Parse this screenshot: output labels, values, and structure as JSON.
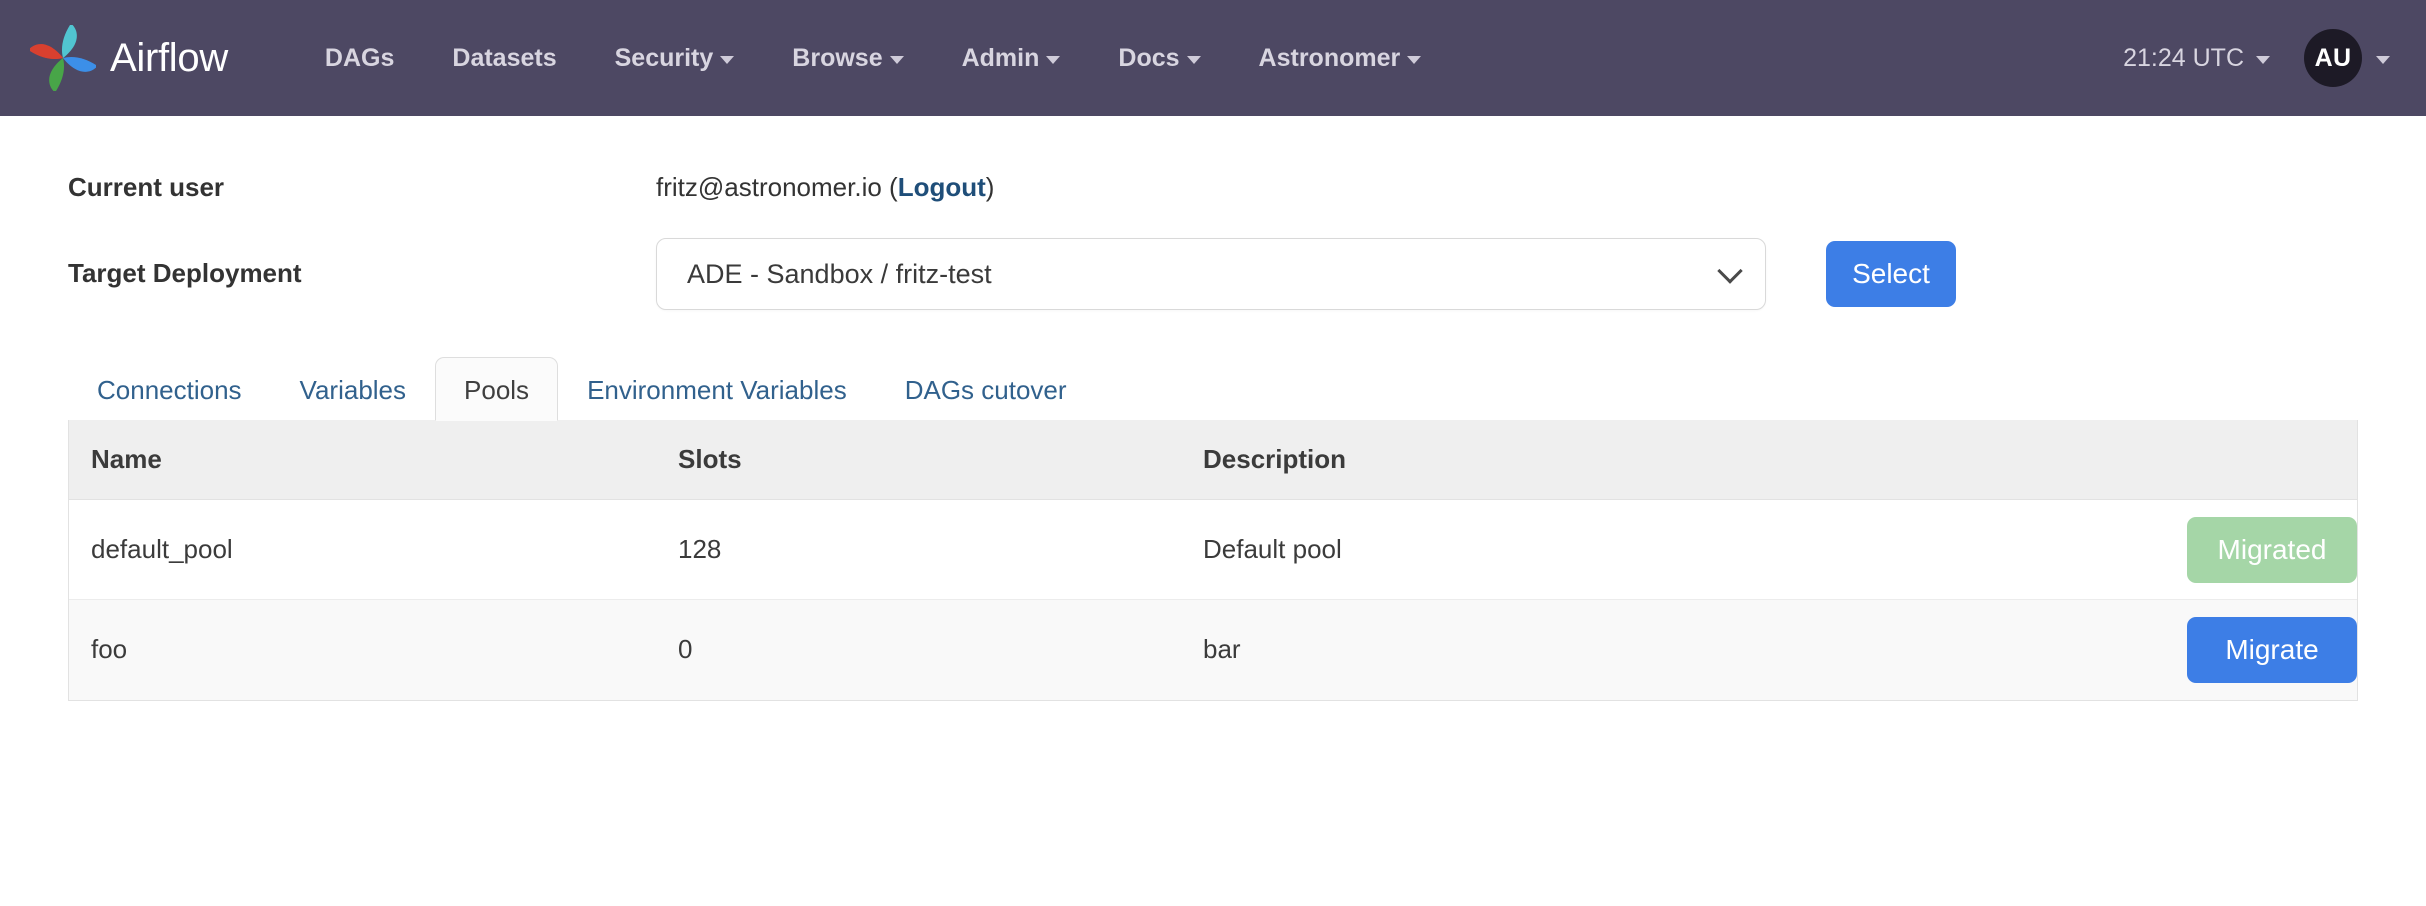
{
  "navbar": {
    "brand": "Airflow",
    "brand_logo_icon": "airflow-pinwheel-logo",
    "links": [
      {
        "label": "DAGs",
        "has_caret": false
      },
      {
        "label": "Datasets",
        "has_caret": false
      },
      {
        "label": "Security",
        "has_caret": true
      },
      {
        "label": "Browse",
        "has_caret": true
      },
      {
        "label": "Admin",
        "has_caret": true
      },
      {
        "label": "Docs",
        "has_caret": true
      },
      {
        "label": "Astronomer",
        "has_caret": true
      }
    ],
    "clock": "21:24 UTC",
    "avatar_initials": "AU",
    "background_color": "#4d4863",
    "link_color": "#d8d5e0"
  },
  "current_user": {
    "label": "Current user",
    "email": "fritz@astronomer.io",
    "logout_label": "Logout",
    "open_paren": "(",
    "close_paren": ")"
  },
  "target_deployment": {
    "label": "Target Deployment",
    "selected_value": "ADE - Sandbox / fritz-test",
    "select_button_label": "Select",
    "chevron_icon": "chevron-down-icon",
    "button_color": "#3d7ee6"
  },
  "tabs": [
    {
      "label": "Connections",
      "active": false
    },
    {
      "label": "Variables",
      "active": false
    },
    {
      "label": "Pools",
      "active": true
    },
    {
      "label": "Environment Variables",
      "active": false
    },
    {
      "label": "DAGs cutover",
      "active": false
    }
  ],
  "pools_table": {
    "columns": [
      "Name",
      "Slots",
      "Description",
      ""
    ],
    "rows": [
      {
        "name": "default_pool",
        "slots": "128",
        "description": "Default pool",
        "action_label": "Migrated",
        "action_state": "migrated",
        "action_color": "#a5d6a7"
      },
      {
        "name": "foo",
        "slots": "0",
        "description": "bar",
        "action_label": "Migrate",
        "action_state": "pending",
        "action_color": "#3d7ee6"
      }
    ]
  }
}
